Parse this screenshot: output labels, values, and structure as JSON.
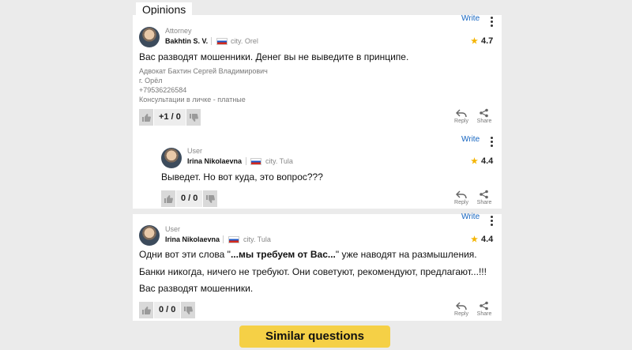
{
  "section": {
    "title": "Opinions"
  },
  "comments": [
    {
      "write_label": "Write",
      "role": "Attorney",
      "name": "Bakhtin S. V.",
      "city": "city. Orel",
      "rating": "4.7",
      "lines": [
        "Вас разводят мошенники. Денег вы не выведите в принципе."
      ],
      "signature": [
        "Адвокат Бахтин Сергей Владимирович",
        "г. Орёл",
        "+79536226584",
        "Консультации в личке - платные"
      ],
      "votes": "+1 / 0",
      "reply_label": "Reply",
      "share_label": "Share"
    },
    {
      "write_label": "Write",
      "role": "User",
      "name": "Irina Nikolaevna",
      "city": "city. Tula",
      "rating": "4.4",
      "lines": [
        "Выведет. Но вот куда, это вопрос???"
      ],
      "votes": "0 / 0",
      "reply_label": "Reply",
      "share_label": "Share"
    },
    {
      "write_label": "Write",
      "role": "User",
      "name": "Irina Nikolaevna",
      "city": "city. Tula",
      "rating": "4.4",
      "line1_before": "Одни вот эти слова \"",
      "line1_bold": "...мы требуем от Вас...",
      "line1_after": "\" уже наводят на размышления.",
      "lines": [
        "Банки никогда, ничего не требуют. Они советуют, рекомендуют, предлагают...!!!",
        "Вас разводят мошенники."
      ],
      "votes": "0 / 0",
      "reply_label": "Reply",
      "share_label": "Share"
    }
  ],
  "similar_button": "Similar questions"
}
